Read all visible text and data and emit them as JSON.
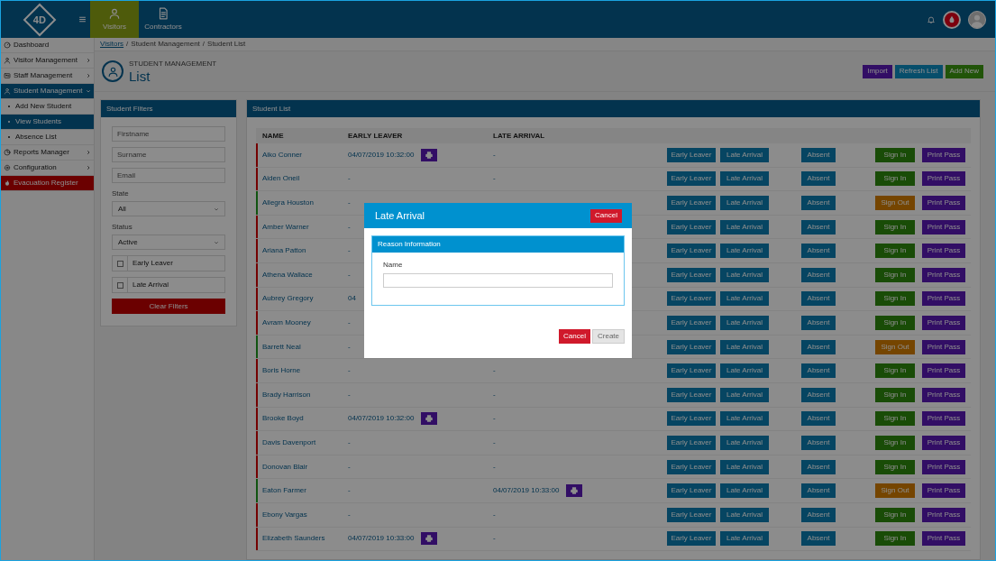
{
  "header": {
    "logo": "4D",
    "tabs": [
      {
        "label": "Visitors",
        "selected": true
      },
      {
        "label": "Contractors",
        "selected": false
      }
    ]
  },
  "sidebar": {
    "items": [
      {
        "label": "Dashboard",
        "kind": "menu",
        "selected": false
      },
      {
        "label": "Visitor Management",
        "kind": "menu",
        "selected": false,
        "expanded": false
      },
      {
        "label": "Staff Management",
        "kind": "menu",
        "selected": false,
        "expanded": false
      },
      {
        "label": "Student Management",
        "kind": "menu",
        "selected": true,
        "expanded": true,
        "children": [
          {
            "label": "Add New Student",
            "selected": false
          },
          {
            "label": "View Students",
            "selected": true
          },
          {
            "label": "Absence List",
            "selected": false
          }
        ]
      },
      {
        "label": "Reports Manager",
        "kind": "menu",
        "selected": false,
        "expanded": false
      },
      {
        "label": "Configuration",
        "kind": "menu",
        "selected": false,
        "expanded": false
      },
      {
        "label": "Evacuation Register",
        "kind": "alert"
      }
    ]
  },
  "breadcrumb": [
    {
      "label": "Visitors",
      "link": true
    },
    {
      "label": "/",
      "link": false
    },
    {
      "label": "Student Management",
      "link": false
    },
    {
      "label": "/",
      "link": false
    },
    {
      "label": "Student List",
      "link": false
    }
  ],
  "page": {
    "subtitle": "STUDENT MANAGEMENT",
    "title": "List",
    "actions": [
      "Import",
      "Refresh List",
      "Add New"
    ]
  },
  "filters": {
    "title": "Student Filters",
    "fields": [
      {
        "placeholder": "Firstname"
      },
      {
        "placeholder": "Surname"
      },
      {
        "placeholder": "Email"
      }
    ],
    "selects": [
      {
        "label": "State",
        "value": "All"
      },
      {
        "label": "Status",
        "value": "Active"
      }
    ],
    "checkboxes": [
      {
        "label": "Early Leaver",
        "checked": false
      },
      {
        "label": "Late Arrival",
        "checked": false
      }
    ],
    "clear_button": "Clear Filters"
  },
  "student_list": {
    "title": "Student List",
    "columns": [
      "NAME",
      "EARLY LEAVER",
      "LATE ARRIVAL"
    ],
    "rows": [
      {
        "name": "Aiko Conner",
        "early_leaver": "04/07/2019 10:32:00",
        "early_print": true,
        "late_arrival": "-",
        "late_print": false,
        "signed_in": false,
        "actions": [
          "Early Leaver",
          "Late Arrival",
          "Absent",
          "Sign In",
          "Print Pass"
        ]
      },
      {
        "name": "Aiden Oneil",
        "early_leaver": "-",
        "early_print": false,
        "late_arrival": "-",
        "late_print": false,
        "signed_in": false,
        "actions": [
          "Early Leaver",
          "Late Arrival",
          "Absent",
          "Sign In",
          "Print Pass"
        ]
      },
      {
        "name": "Allegra Houston",
        "early_leaver": "-",
        "early_print": false,
        "signed_in": true,
        "actions": [
          "Early Leaver",
          "Late Arrival",
          "Absent",
          "Sign Out",
          "Print Pass"
        ]
      },
      {
        "name": "Amber Warner",
        "early_leaver": "-",
        "early_print": false,
        "signed_in": false,
        "actions": [
          "Early Leaver",
          "Late Arrival",
          "Absent",
          "Sign In",
          "Print Pass"
        ]
      },
      {
        "name": "Ariana Patton",
        "early_leaver": "-",
        "early_print": false,
        "signed_in": false,
        "actions": [
          "Early Leaver",
          "Late Arrival",
          "Absent",
          "Sign In",
          "Print Pass"
        ]
      },
      {
        "name": "Athena Wallace",
        "early_leaver": "-",
        "early_print": false,
        "signed_in": false,
        "actions": [
          "Early Leaver",
          "Late Arrival",
          "Absent",
          "Sign In",
          "Print Pass"
        ]
      },
      {
        "name": "Aubrey Gregory",
        "early_leaver": "04",
        "early_print": false,
        "signed_in": false,
        "actions": [
          "Early Leaver",
          "Late Arrival",
          "Absent",
          "Sign In",
          "Print Pass"
        ]
      },
      {
        "name": "Avram Mooney",
        "early_leaver": "-",
        "early_print": false,
        "signed_in": false,
        "actions": [
          "Early Leaver",
          "Late Arrival",
          "Absent",
          "Sign In",
          "Print Pass"
        ]
      },
      {
        "name": "Barrett Neal",
        "early_leaver": "-",
        "early_print": false,
        "signed_in": true,
        "actions": [
          "Early Leaver",
          "Late Arrival",
          "Absent",
          "Sign Out",
          "Print Pass"
        ]
      },
      {
        "name": "Boris Horne",
        "early_leaver": "-",
        "early_print": false,
        "late_arrival": "-",
        "late_print": false,
        "signed_in": false,
        "actions": [
          "Early Leaver",
          "Late Arrival",
          "Absent",
          "Sign In",
          "Print Pass"
        ]
      },
      {
        "name": "Brady Harrison",
        "early_leaver": "-",
        "early_print": false,
        "late_arrival": "-",
        "late_print": false,
        "signed_in": false,
        "actions": [
          "Early Leaver",
          "Late Arrival",
          "Absent",
          "Sign In",
          "Print Pass"
        ]
      },
      {
        "name": "Brooke Boyd",
        "early_leaver": "04/07/2019 10:32:00",
        "early_print": true,
        "late_arrival": "-",
        "late_print": false,
        "signed_in": false,
        "actions": [
          "Early Leaver",
          "Late Arrival",
          "Absent",
          "Sign In",
          "Print Pass"
        ]
      },
      {
        "name": "Davis Davenport",
        "early_leaver": "-",
        "early_print": false,
        "late_arrival": "-",
        "late_print": false,
        "signed_in": false,
        "actions": [
          "Early Leaver",
          "Late Arrival",
          "Absent",
          "Sign In",
          "Print Pass"
        ]
      },
      {
        "name": "Donovan Blair",
        "early_leaver": "-",
        "early_print": false,
        "late_arrival": "-",
        "late_print": false,
        "signed_in": false,
        "actions": [
          "Early Leaver",
          "Late Arrival",
          "Absent",
          "Sign In",
          "Print Pass"
        ]
      },
      {
        "name": "Eaton Farmer",
        "early_leaver": "-",
        "early_print": false,
        "late_arrival": "04/07/2019 10:33:00",
        "late_print": true,
        "signed_in": true,
        "actions": [
          "Early Leaver",
          "Late Arrival",
          "Absent",
          "Sign Out",
          "Print Pass"
        ]
      },
      {
        "name": "Ebony Vargas",
        "early_leaver": "-",
        "early_print": false,
        "late_arrival": "-",
        "late_print": false,
        "signed_in": false,
        "actions": [
          "Early Leaver",
          "Late Arrival",
          "Absent",
          "Sign In",
          "Print Pass"
        ]
      },
      {
        "name": "Elizabeth Saunders",
        "early_leaver": "04/07/2019 10:33:00",
        "early_print": true,
        "late_arrival": "-",
        "late_print": false,
        "signed_in": false,
        "actions": [
          "Early Leaver",
          "Late Arrival",
          "Absent",
          "Sign In",
          "Print Pass"
        ]
      }
    ]
  },
  "modal": {
    "title": "Late Arrival",
    "header_button": "Cancel",
    "section_title": "Reason Information",
    "field_label": "Name",
    "buttons": [
      {
        "label": "Cancel",
        "kind": "danger",
        "disabled": false
      },
      {
        "label": "Create",
        "kind": "default",
        "disabled": true
      }
    ]
  }
}
